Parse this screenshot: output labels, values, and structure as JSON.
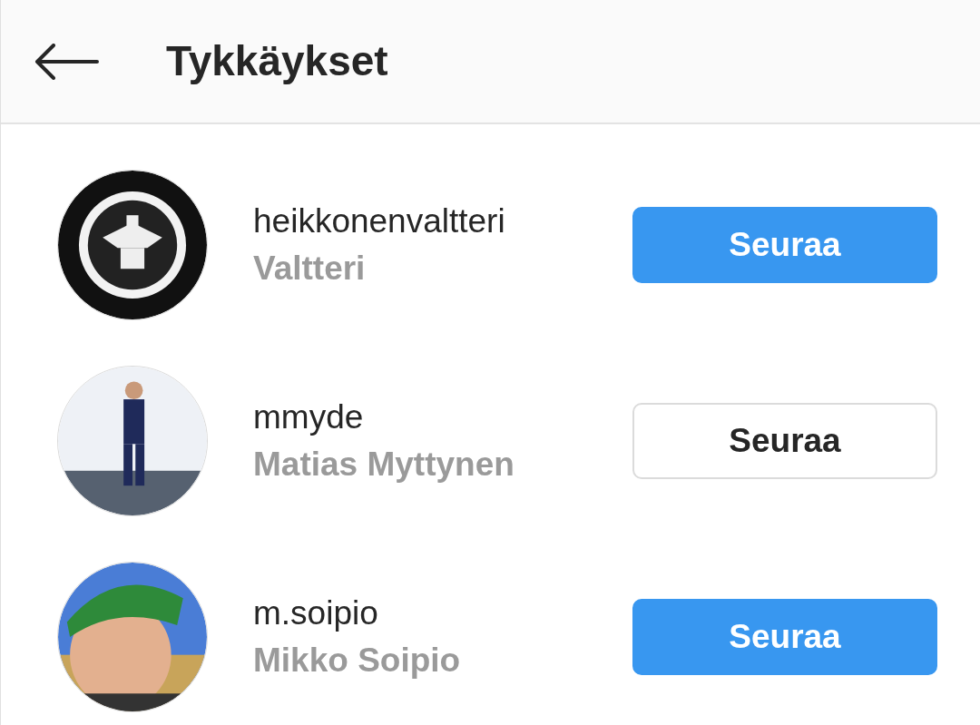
{
  "header": {
    "title": "Tykkäykset"
  },
  "users": [
    {
      "username": "heikkonenvaltteri",
      "name": "Valtteri",
      "button": {
        "label": "Seuraa",
        "kind": "filled"
      }
    },
    {
      "username": "mmyde",
      "name": "Matias Myttynen",
      "button": {
        "label": "Seuraa",
        "kind": "outline"
      }
    },
    {
      "username": "m.soipio",
      "name": "Mikko Soipio",
      "button": {
        "label": "Seuraa",
        "kind": "filled"
      }
    }
  ]
}
